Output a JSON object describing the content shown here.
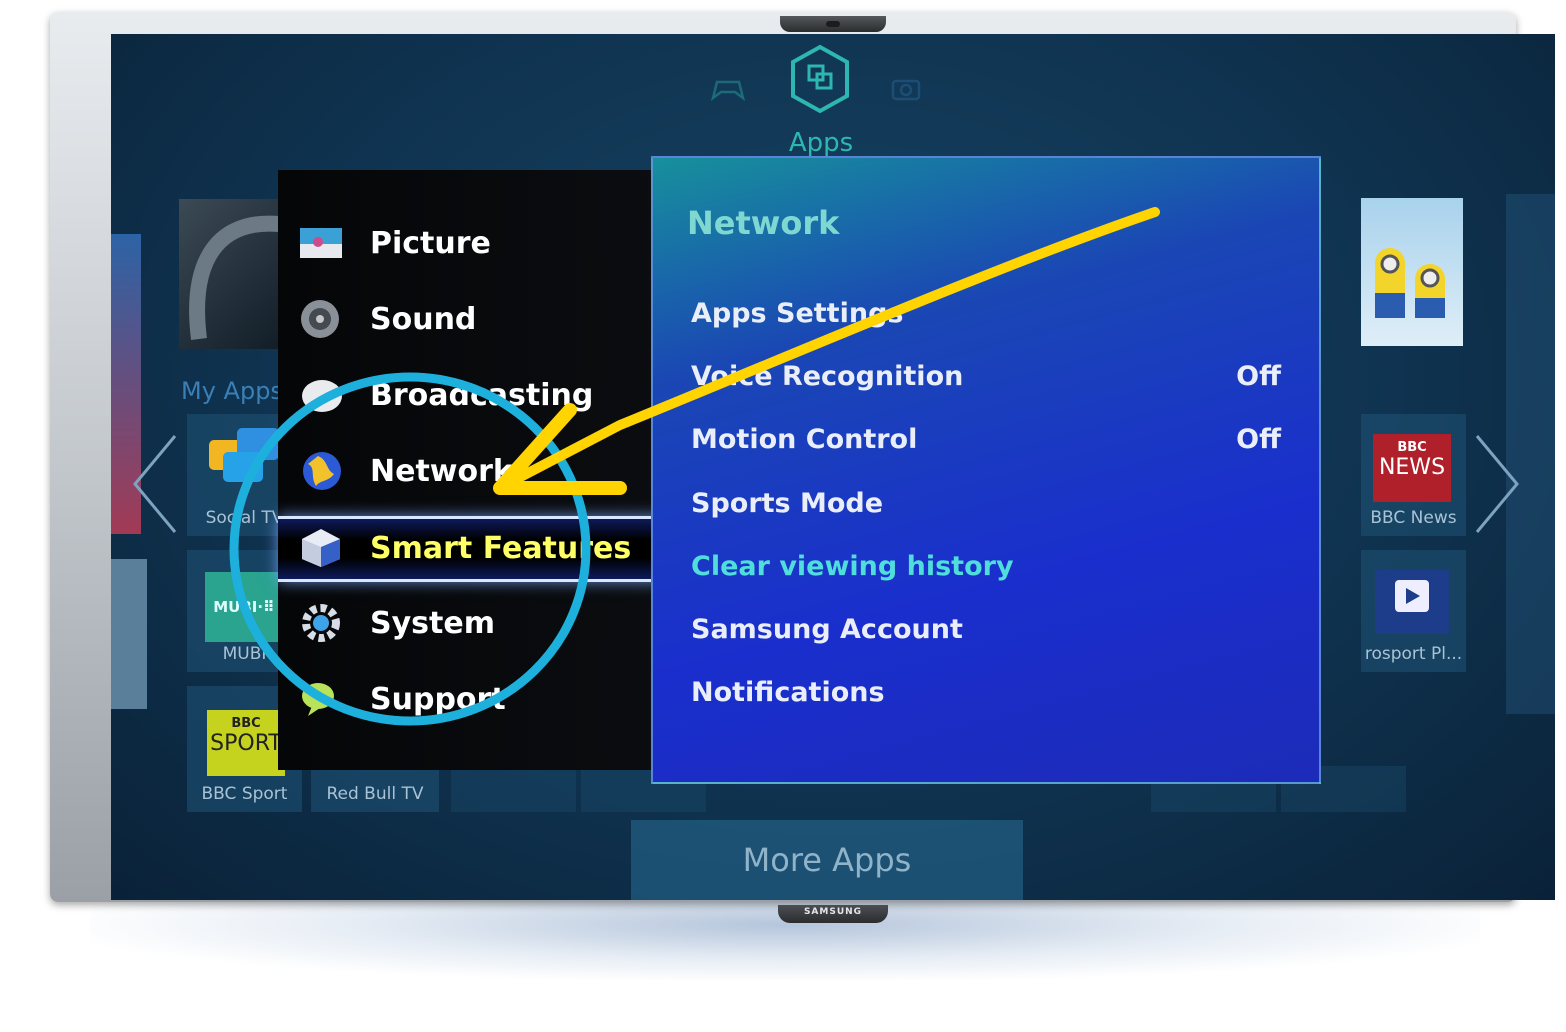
{
  "header": {
    "active_section": "Apps",
    "icons": [
      "gamepad-icon",
      "apps-icon",
      "camera-icon"
    ]
  },
  "left_area": {
    "section_label": "My Apps",
    "tiles": [
      {
        "label": "Social TV",
        "icon": "chat-bubbles-icon"
      },
      {
        "label": "MUBI",
        "logo_text": "MUBI·⠿"
      },
      {
        "label": "BBC Sport",
        "logo_text_top": "BBC",
        "logo_text_bottom": "SPORT"
      },
      {
        "label": "Red Bull TV"
      }
    ]
  },
  "right_area": {
    "tiles": [
      {
        "label": "BBC News",
        "logo_text_top": "BBC",
        "logo_text_bottom": "NEWS"
      },
      {
        "label": "rosport Pl...",
        "icon": "play-icon"
      }
    ]
  },
  "menu": {
    "items": [
      {
        "label": "Picture",
        "icon": "picture-icon"
      },
      {
        "label": "Sound",
        "icon": "speaker-icon"
      },
      {
        "label": "Broadcasting",
        "icon": "satellite-dish-icon"
      },
      {
        "label": "Network",
        "icon": "globe-icon"
      },
      {
        "label": "Smart Features",
        "icon": "smart-hub-cube-icon",
        "selected": true
      },
      {
        "label": "System",
        "icon": "gear-icon"
      },
      {
        "label": "Support",
        "icon": "support-bubble-icon"
      }
    ]
  },
  "submenu": {
    "title": "Network",
    "items": [
      {
        "label": "Apps Settings",
        "value": ""
      },
      {
        "label": "Voice Recognition",
        "value": "Off"
      },
      {
        "label": "Motion Control",
        "value": "Off"
      },
      {
        "label": "Sports Mode",
        "value": ""
      },
      {
        "label": "Clear viewing history",
        "value": "",
        "highlighted": true
      },
      {
        "label": "Samsung Account",
        "value": ""
      },
      {
        "label": "Notifications",
        "value": ""
      }
    ]
  },
  "footer": {
    "more_apps_label": "More Apps"
  },
  "tv": {
    "brand": "SAMSUNG"
  },
  "colors": {
    "annotation_circle": "#1eb0dc",
    "annotation_arrow": "#ffd400",
    "selected_text": "#ffff66",
    "accent_teal": "#2eb6b0"
  }
}
